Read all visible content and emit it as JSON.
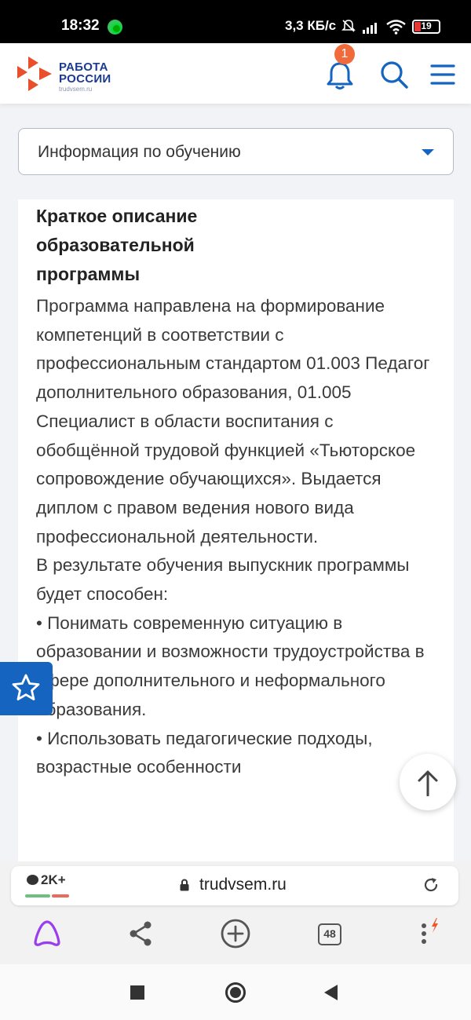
{
  "status_bar": {
    "time": "18:32",
    "speed": "3,3 КБ/с",
    "battery": "19",
    "icons": [
      "app-notification-icon",
      "mute-icon",
      "signal-icon",
      "wifi-icon",
      "battery-icon"
    ]
  },
  "header": {
    "logo_title": "РАБОТА РОССИИ",
    "logo_line1": "РАБОТА",
    "logo_line2": "РОССИИ",
    "logo_sub": "trudvsem.ru",
    "notification_count": "1",
    "icons": [
      "bell-icon",
      "search-icon",
      "menu-icon"
    ],
    "accent_color": "#1565c0",
    "badge_color": "#f06a3c"
  },
  "dropdown": {
    "selected": "Информация по обучению"
  },
  "content": {
    "title": "Краткое описание образовательной программы",
    "paragraph": "Программа направлена на формирование компетенций в соответствии с профессиональным стандартом 01.003 Педагог дополнительного образования, 01.005 Специалист в области воспитания с обобщённой трудовой функцией «Тьюторское сопровождение обучающихся». Выдается диплом с правом ведения нового вида профессиональной деятельности.",
    "result_intro": "В результате обучения выпускник программы будет способен:",
    "bullet1": "• Понимать современную ситуацию в образовании и возможности трудоустройства в сфере дополнительного и неформального образования.",
    "bullet2": "• Использовать  педагогические подходы, возрастные особенности"
  },
  "browser": {
    "comments": "2K+",
    "url": "trudvsem.ru",
    "tabs": "48",
    "nav_icons": [
      "alice-icon",
      "share-icon",
      "new-tab-icon",
      "tabs-icon",
      "more-icon"
    ]
  },
  "system_nav": {
    "icons": [
      "recent-apps-icon",
      "home-icon",
      "back-icon"
    ]
  }
}
